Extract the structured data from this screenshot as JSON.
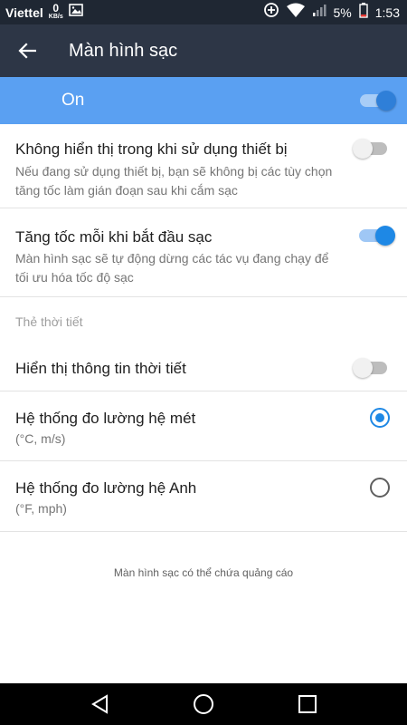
{
  "status_bar": {
    "carrier": "Viettel",
    "net_speed_value": "0",
    "net_speed_unit": "KB/s",
    "battery_percent": "5%",
    "time": "1:53",
    "icons": [
      "image-icon",
      "sync-icon",
      "wifi-icon",
      "signal-icon",
      "battery-icon"
    ]
  },
  "app_bar": {
    "back_icon": "arrow-left-icon",
    "title": "Màn hình sạc"
  },
  "master": {
    "label": "On",
    "enabled": true
  },
  "settings": [
    {
      "title": "Không hiển thị trong khi sử dụng thiết bị",
      "description": "Nếu đang sử dụng thiết bị, bạn sẽ không bị các tùy chọn tăng tốc làm gián đoạn sau khi cắm sạc",
      "enabled": false
    },
    {
      "title": "Tăng tốc mỗi khi bắt đầu sạc",
      "description": "Màn hình sạc sẽ tự động dừng các tác vụ đang chạy để tối ưu hóa tốc độ sạc",
      "enabled": true
    }
  ],
  "weather_section": {
    "header": "Thẻ thời tiết",
    "show_weather_label": "Hiển thị thông tin thời tiết",
    "show_weather_enabled": false,
    "units": [
      {
        "title": "Hệ thống đo lường hệ mét",
        "subtitle": "(°C, m/s)",
        "selected": true
      },
      {
        "title": "Hệ thống đo lường hệ Anh",
        "subtitle": "(°F, mph)",
        "selected": false
      }
    ]
  },
  "footer_note": "Màn hình sạc có thể chứa quảng cáo",
  "nav_bar": {
    "icons": [
      "back-triangle-icon",
      "home-circle-icon",
      "recents-square-icon"
    ]
  },
  "colors": {
    "status_bar": "#1f2733",
    "app_bar": "#2d3646",
    "accent": "#5aa0f2",
    "toggle_on": "#1e88e5"
  }
}
